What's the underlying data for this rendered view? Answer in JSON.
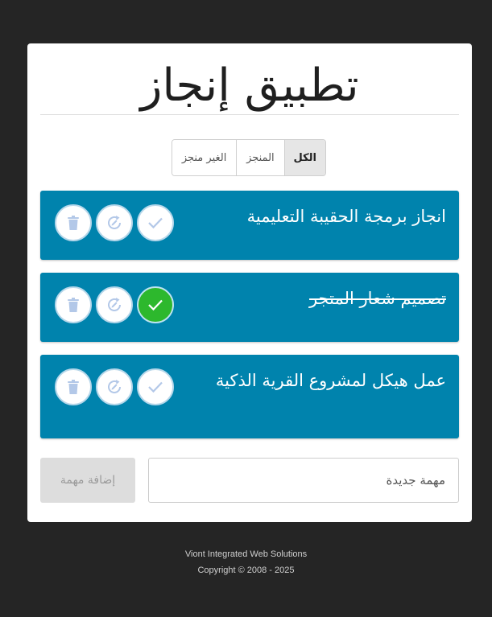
{
  "app": {
    "title": "تطبيق إنجاز"
  },
  "filters": [
    {
      "label": "الكل",
      "active": true
    },
    {
      "label": "المنجز",
      "active": false
    },
    {
      "label": "الغير منجز",
      "active": false
    }
  ],
  "tasks": [
    {
      "text": "انجاز برمجة الحقيبة التعليمية",
      "done": false
    },
    {
      "text": "تصميم شعار المتجر",
      "done": true
    },
    {
      "text": "عمل هيكل لمشروع القرية الذكية",
      "done": false
    }
  ],
  "new_task": {
    "placeholder": "مهمة جديدة",
    "add_label": "إضافة مهمة"
  },
  "footer": {
    "company": "Viont Integrated Web Solutions",
    "copyright": "Copyright © 2008 - 2025"
  },
  "colors": {
    "background": "#252525",
    "task_card": "#0083ad",
    "done_check": "#2db82d",
    "icon": "#b3c8e8"
  },
  "icons": {
    "check": "check-icon",
    "edit": "refresh-edit-icon",
    "delete": "trash-icon"
  }
}
